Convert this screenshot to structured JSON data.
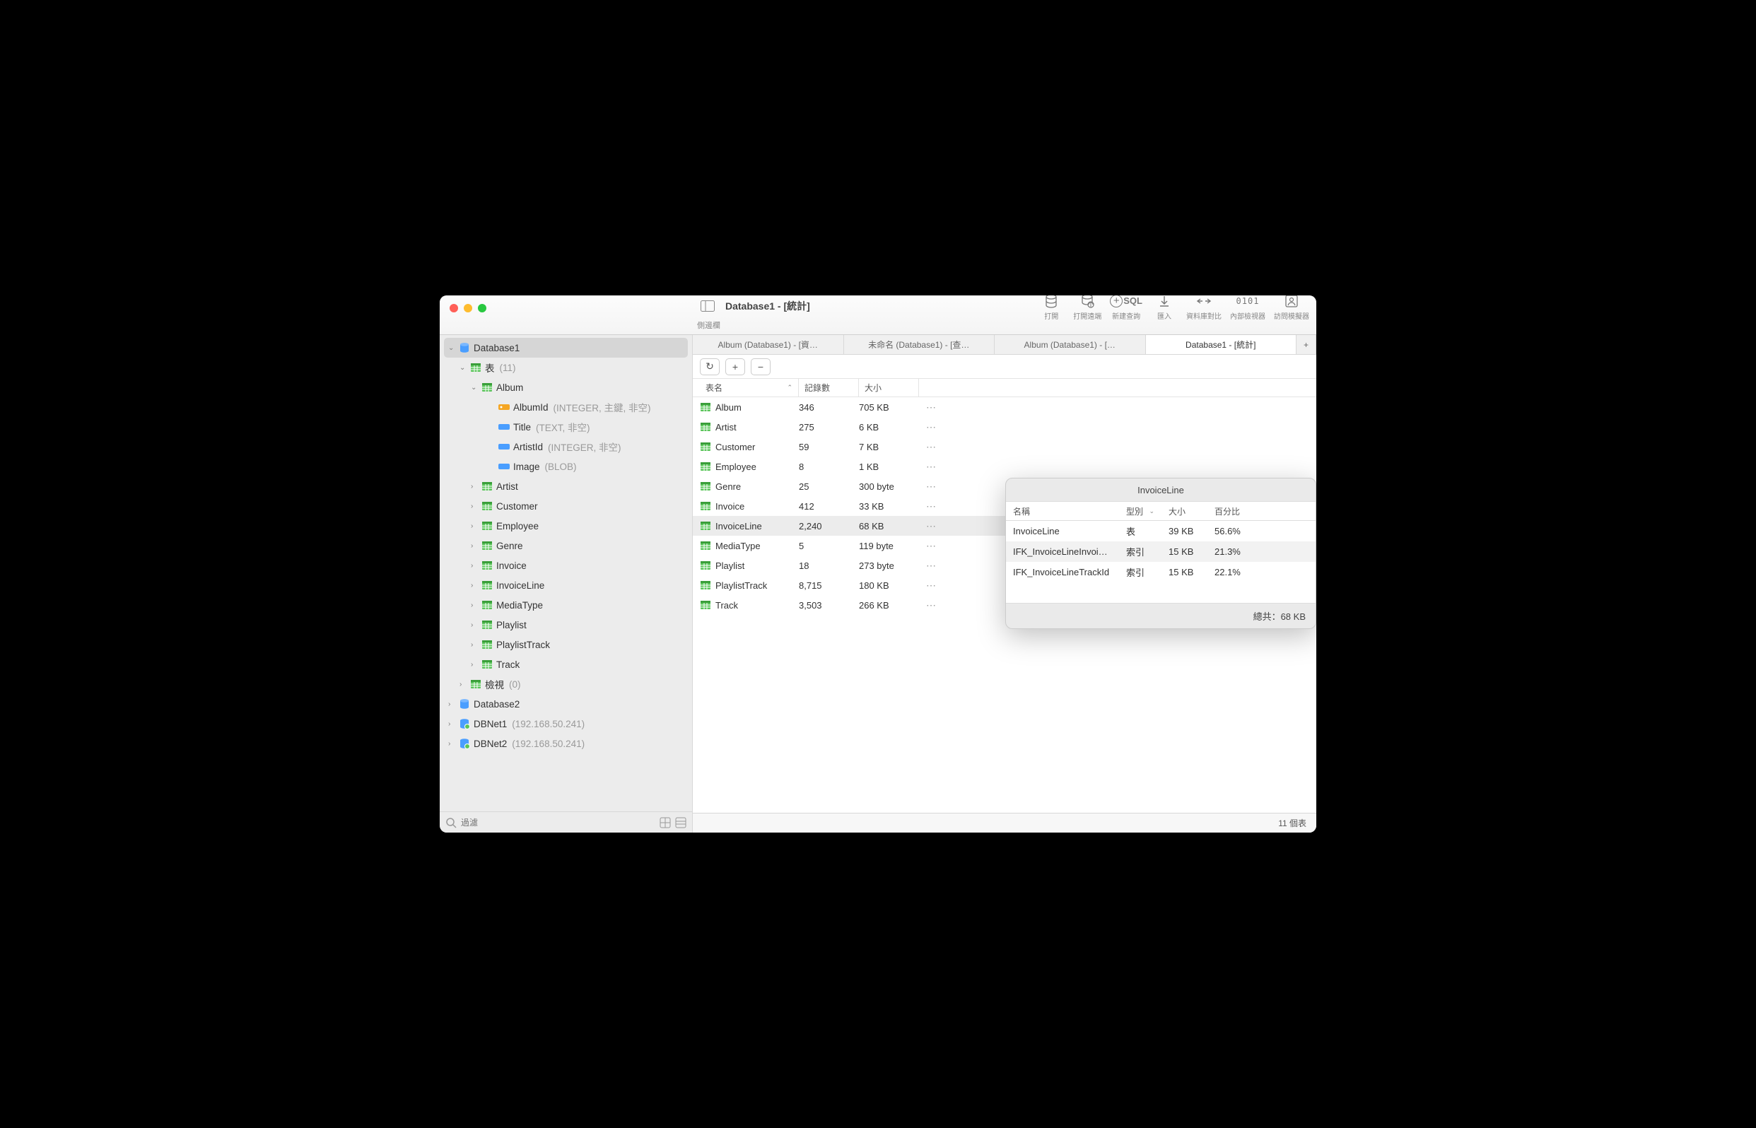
{
  "window_title": "Database1 - [統計]",
  "sidebar_btn_label": "側邊欄",
  "toolbar": [
    {
      "name": "open",
      "label": "打開",
      "icon": "db"
    },
    {
      "name": "open-remote",
      "label": "打開遠端",
      "icon": "dbnet"
    },
    {
      "name": "new-query",
      "label": "新建查詢",
      "icon": "sql"
    },
    {
      "name": "import",
      "label": "匯入",
      "icon": "down"
    },
    {
      "name": "compare",
      "label": "資料庫對比",
      "icon": "compare"
    },
    {
      "name": "inspector",
      "label": "內部檢視器",
      "icon": "binary"
    },
    {
      "name": "simulator",
      "label": "訪問模擬器",
      "icon": "person"
    }
  ],
  "tabs": [
    {
      "label": "Album (Database1) - [資…",
      "active": false
    },
    {
      "label": "未命名 (Database1) - [查…",
      "active": false
    },
    {
      "label": "Album (Database1) - […",
      "active": false
    },
    {
      "label": "Database1 - [統計]",
      "active": true
    }
  ],
  "sidebar": {
    "db1": "Database1",
    "tables_label": "表",
    "tables_count": "(11)",
    "album": "Album",
    "cols": [
      {
        "name": "AlbumId",
        "meta": "(INTEGER, 主鍵, 非空)",
        "pk": true
      },
      {
        "name": "Title",
        "meta": "(TEXT, 非空)",
        "pk": false
      },
      {
        "name": "ArtistId",
        "meta": "(INTEGER, 非空)",
        "pk": false
      },
      {
        "name": "Image",
        "meta": "(BLOB)",
        "pk": false
      }
    ],
    "tlist": [
      "Artist",
      "Customer",
      "Employee",
      "Genre",
      "Invoice",
      "InvoiceLine",
      "MediaType",
      "Playlist",
      "PlaylistTrack",
      "Track"
    ],
    "views_label": "檢視",
    "views_count": "(0)",
    "db2": "Database2",
    "net1": "DBNet1",
    "net1_meta": "(192.168.50.241)",
    "net2": "DBNet2",
    "net2_meta": "(192.168.50.241)",
    "filter_placeholder": "過濾"
  },
  "columns": {
    "name": "表名",
    "records": "記錄數",
    "size": "大小"
  },
  "table_rows": [
    {
      "name": "Album",
      "records": "346",
      "size": "705 KB"
    },
    {
      "name": "Artist",
      "records": "275",
      "size": "6 KB"
    },
    {
      "name": "Customer",
      "records": "59",
      "size": "7 KB"
    },
    {
      "name": "Employee",
      "records": "8",
      "size": "1 KB"
    },
    {
      "name": "Genre",
      "records": "25",
      "size": "300 byte"
    },
    {
      "name": "Invoice",
      "records": "412",
      "size": "33 KB"
    },
    {
      "name": "InvoiceLine",
      "records": "2,240",
      "size": "68 KB",
      "sel": true
    },
    {
      "name": "MediaType",
      "records": "5",
      "size": "119 byte"
    },
    {
      "name": "Playlist",
      "records": "18",
      "size": "273 byte"
    },
    {
      "name": "PlaylistTrack",
      "records": "8,715",
      "size": "180 KB"
    },
    {
      "name": "Track",
      "records": "3,503",
      "size": "266 KB"
    }
  ],
  "footer": "11 個表",
  "popover": {
    "title": "InvoiceLine",
    "cols": {
      "name": "名稱",
      "type": "型別",
      "size": "大小",
      "pct": "百分比"
    },
    "rows": [
      {
        "name": "InvoiceLine",
        "type": "表",
        "size": "39 KB",
        "pct": "56.6%"
      },
      {
        "name": "IFK_InvoiceLineInvoi…",
        "type": "索引",
        "size": "15 KB",
        "pct": "21.3%"
      },
      {
        "name": "IFK_InvoiceLineTrackId",
        "type": "索引",
        "size": "15 KB",
        "pct": "22.1%"
      }
    ],
    "total": "總共：68 KB"
  }
}
